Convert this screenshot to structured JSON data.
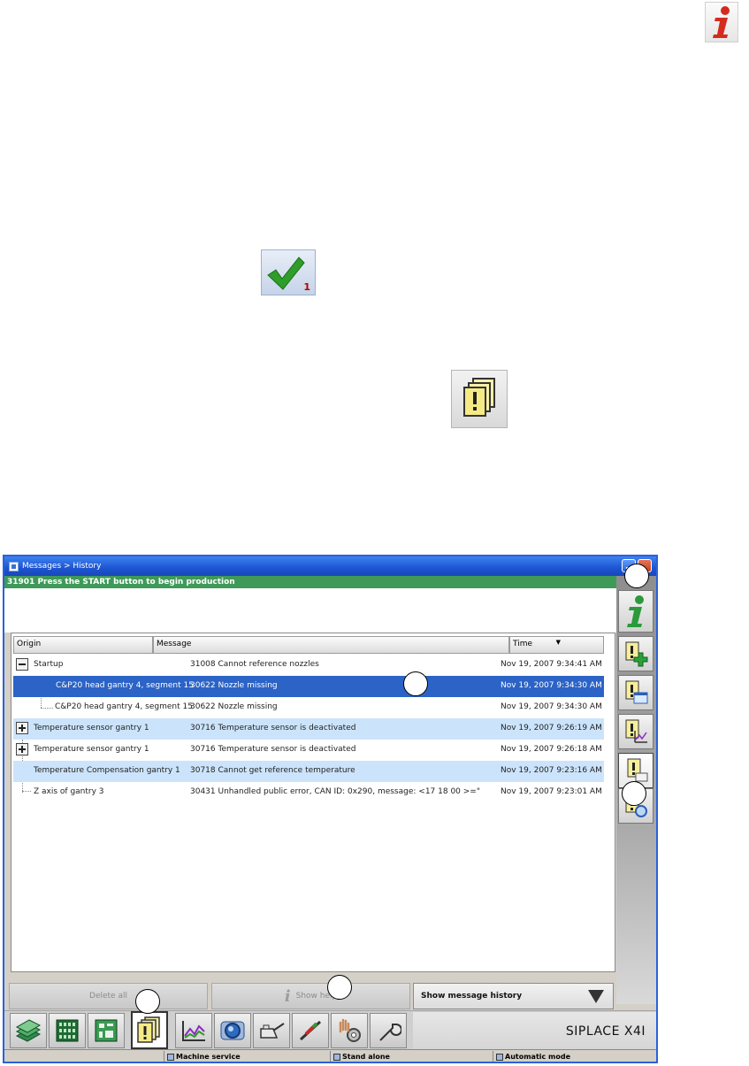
{
  "window": {
    "title": "Messages > History"
  },
  "status_message": "31901 Press the START button to begin production",
  "table": {
    "columns": [
      "Origin",
      "Message",
      "Time"
    ],
    "rows": [
      {
        "origin": "Startup",
        "message": "31008 Cannot reference nozzles",
        "time": "Nov 19, 2007 9:34:41 AM"
      },
      {
        "origin": "C&P20 head gantry 4, segment 15",
        "message": "30622 Nozzle missing",
        "time": "Nov 19, 2007 9:34:30 AM"
      },
      {
        "origin": "C&P20 head gantry 4, segment 15",
        "message": "30622 Nozzle missing",
        "time": "Nov 19, 2007 9:34:30 AM"
      },
      {
        "origin": "Temperature sensor gantry 1",
        "message": "30716 Temperature sensor is deactivated",
        "time": "Nov 19, 2007 9:26:19 AM"
      },
      {
        "origin": "Temperature sensor gantry 1",
        "message": "30716 Temperature sensor is deactivated",
        "time": "Nov 19, 2007 9:26:18 AM"
      },
      {
        "origin": "Temperature Compensation gantry 1",
        "message": "30718 Cannot get reference temperature",
        "time": "Nov 19, 2007 9:23:16 AM"
      },
      {
        "origin": "Z axis of gantry 3",
        "message": "30431 Unhandled public error, CAN ID: 0x290, message: <17 18 00 >=\"",
        "time": "Nov 19, 2007 9:23:01 AM"
      }
    ]
  },
  "buttons": {
    "delete_all": "Delete all",
    "show_help": "Show help",
    "show_history": "Show message history"
  },
  "brand": "SIPLACE X4I",
  "footer": {
    "mode1": "Machine service",
    "mode2": "Stand alone",
    "mode3": "Automatic mode"
  },
  "doc_icons": {
    "check_count": "1"
  },
  "colors": {
    "titlebar": "#1d55d2",
    "status_bar": "#3f9a59",
    "selected_row": "#2b63c6",
    "alt_row": "#cce4fb"
  }
}
